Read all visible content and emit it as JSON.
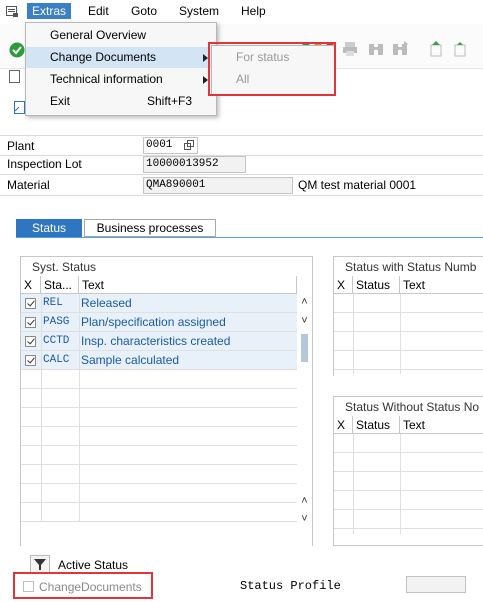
{
  "menubar": {
    "items": [
      "Extras",
      "Edit",
      "Goto",
      "System",
      "Help"
    ]
  },
  "extras_menu": {
    "items": [
      {
        "label": "General Overview",
        "shortcut": ""
      },
      {
        "label": "Change Documents",
        "shortcut": ""
      },
      {
        "label": "Technical information",
        "shortcut": ""
      },
      {
        "label": "Exit",
        "shortcut": "Shift+F3"
      }
    ]
  },
  "change_documents_submenu": {
    "items": [
      "For status",
      "All"
    ]
  },
  "form": {
    "plant_label": "Plant",
    "plant_value": "0001",
    "inspection_lot_label": "Inspection Lot",
    "inspection_lot_value": "10000013952",
    "material_label": "Material",
    "material_value": "QMA890001",
    "material_description": "QM test material 0001"
  },
  "tabs": [
    "Status",
    "Business processes"
  ],
  "syst_status": {
    "title": "Syst. Status",
    "columns": [
      "X",
      "Sta...",
      "Text"
    ],
    "rows": [
      {
        "checked": true,
        "code": "REL",
        "text": "Released"
      },
      {
        "checked": true,
        "code": "PASG",
        "text": "Plan/specification assigned"
      },
      {
        "checked": true,
        "code": "CCTD",
        "text": "Insp. characteristics created"
      },
      {
        "checked": true,
        "code": "CALC",
        "text": "Sample calculated"
      }
    ]
  },
  "status_with_number": {
    "title": "Status with Status Numb",
    "columns": [
      "X",
      "Status",
      "Text"
    ]
  },
  "status_without_number": {
    "title": "Status Without Status No",
    "columns": [
      "X",
      "Status",
      "Text"
    ]
  },
  "footer": {
    "active_status_label": "Active Status",
    "change_documents_label": "ChangeDocuments",
    "status_profile_label": "Status Profile"
  },
  "colors": {
    "accent": "#2f76c0",
    "highlight_box": "#e0353b",
    "link_text": "#1a5aa8"
  },
  "icons": [
    "menu-icon",
    "confirm-check-icon",
    "print-icon",
    "find-icon",
    "find-next-icon",
    "first-page-icon",
    "previous-page-icon",
    "filter-icon",
    "display-object-icon"
  ]
}
